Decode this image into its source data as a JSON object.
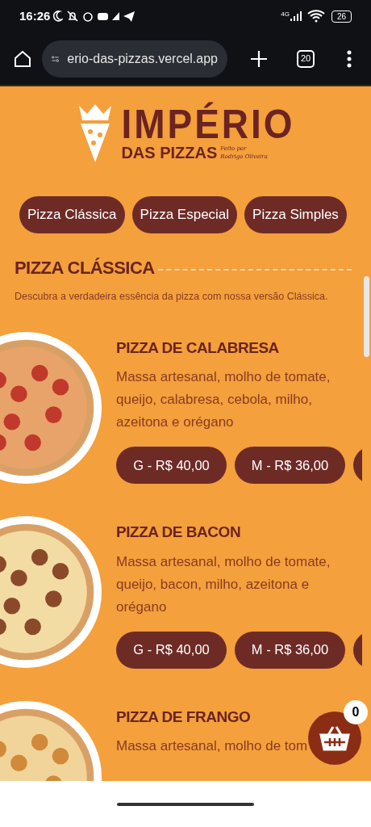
{
  "status_bar": {
    "time": "16:26",
    "battery": "26",
    "network": "4G"
  },
  "browser": {
    "url": "erio-das-pizzas.vercel.app",
    "tab_count": "20"
  },
  "logo": {
    "title": "IMPÉRIO",
    "subtitle": "DAS PIZZAS",
    "signature_top": "Feito por",
    "signature_bottom": "Rodrigo Oliveira"
  },
  "categories": [
    {
      "label": "Pizza Clássica"
    },
    {
      "label": "Pizza Especial"
    },
    {
      "label": "Pizza Simples"
    }
  ],
  "section": {
    "title": "PIZZA CLÁSSICA",
    "description": "Descubra a verdadeira essência da pizza com nossa versão Clássica.",
    "items": [
      {
        "name": "PIZZA DE CALABRESA",
        "description": "Massa artesanal, molho de tomate, queijo, calabresa, cebola, milho, azeitona e orégano",
        "prices": [
          "G - R$ 40,00",
          "M - R$ 36,00"
        ],
        "kind": "pepperoni"
      },
      {
        "name": "PIZZA DE BACON",
        "description": "Massa artesanal, molho de tomate, queijo, bacon, milho, azeitona e orégano",
        "prices": [
          "G - R$ 40,00",
          "M - R$ 36,00"
        ],
        "kind": "cheese"
      },
      {
        "name": "PIZZA DE FRANGO",
        "description": "Massa artesanal, molho de tom",
        "kind": "chicken"
      }
    ]
  },
  "cart": {
    "count": "0"
  }
}
